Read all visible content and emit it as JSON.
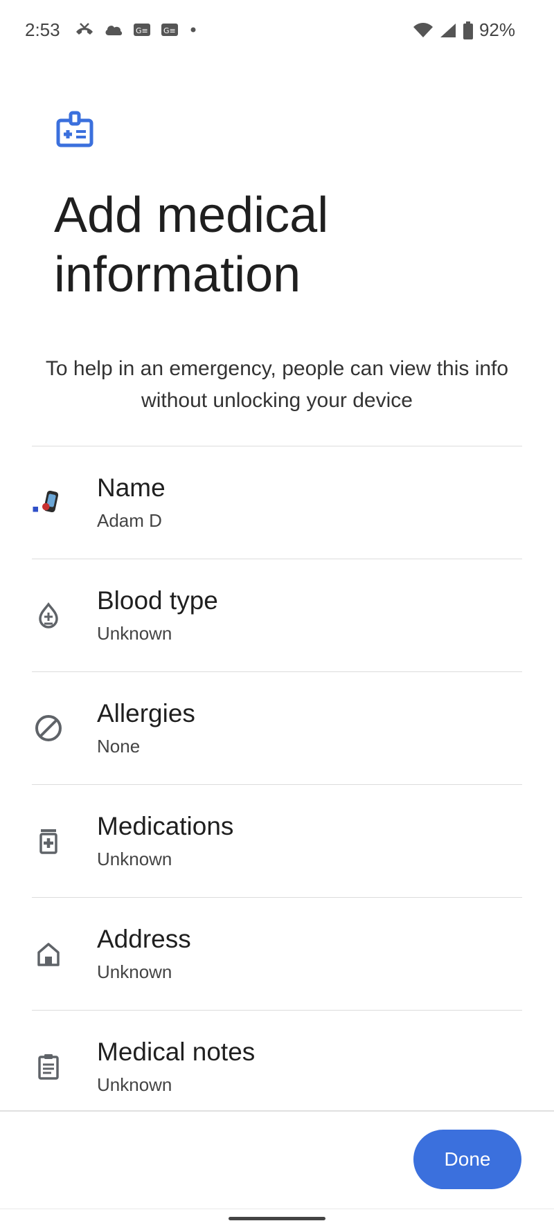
{
  "status_bar": {
    "time": "2:53",
    "battery_percent": "92%",
    "left_icons": [
      "missed-call-icon",
      "cloud-icon",
      "news-icon",
      "news-icon",
      "dot-icon"
    ],
    "right_icons": [
      "wifi-icon",
      "signal-icon",
      "battery-icon"
    ]
  },
  "header": {
    "icon": "medical-id-icon",
    "title": "Add medical information",
    "subtitle": "To help in an emergency, people can view this info without unlocking your device"
  },
  "items": [
    {
      "label": "Name",
      "value": "Adam D",
      "icon": "avatar"
    },
    {
      "label": "Blood type",
      "value": "Unknown",
      "icon": "blood-drop-icon"
    },
    {
      "label": "Allergies",
      "value": "None",
      "icon": "block-icon"
    },
    {
      "label": "Medications",
      "value": "Unknown",
      "icon": "medication-icon"
    },
    {
      "label": "Address",
      "value": "Unknown",
      "icon": "home-icon"
    },
    {
      "label": "Medical notes",
      "value": "Unknown",
      "icon": "clipboard-icon"
    }
  ],
  "footer": {
    "done_label": "Done"
  },
  "colors": {
    "accent": "#3b70dd",
    "icon_grey": "#5f6368"
  }
}
